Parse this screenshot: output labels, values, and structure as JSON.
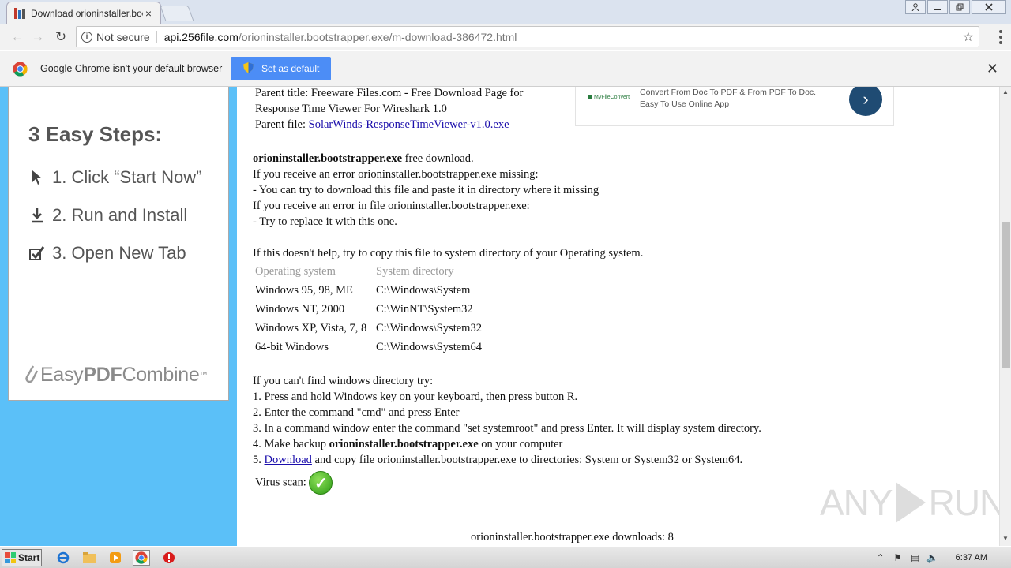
{
  "browser": {
    "tab_title": "Download orioninstaller.boot",
    "tab_close": "×",
    "url_security": "Not secure",
    "url_host": "api.256file.com",
    "url_path": "/orioninstaller.bootstrapper.exe/m-download-386472.html",
    "infobar_text": "Google Chrome isn't your default browser",
    "infobar_button": "Set as default"
  },
  "left_ad": {
    "title": "3 Easy Steps:",
    "steps": [
      "1. Click “Start Now”",
      "2. Run and Install",
      "3. Open New Tab"
    ],
    "brand_light": "Easy",
    "brand_bold": "PDF",
    "brand_rest": "Combine",
    "brand_tm": "™"
  },
  "right_ad": {
    "logo_text": "MyFileConvert",
    "line1": "Convert From Doc To PDF & From PDF To Doc.",
    "line2": "Easy To Use Online App"
  },
  "content": {
    "parent_title_line1": "Parent title: Freeware Files.com - Free Download Page for",
    "parent_title_line2": "Response Time Viewer For Wireshark 1.0",
    "parent_file_label": "Parent file: ",
    "parent_file_link": "SolarWinds-ResponseTimeViewer-v1.0.exe",
    "filename": "orioninstaller.bootstrapper.exe",
    "free_download": " free download.",
    "p1": "If you receive an error orioninstaller.bootstrapper.exe missing:",
    "p2": "- You can try to download this file and paste it in directory where it missing",
    "p3": "If you receive an error in file orioninstaller.bootstrapper.exe:",
    "p4": "- Try to replace it with this one.",
    "p5": "If this doesn't help, try to copy this file to system directory of your Operating system.",
    "table": {
      "headers": [
        "Operating system",
        "System directory"
      ],
      "rows": [
        [
          "Windows 95, 98, ME",
          "C:\\Windows\\System"
        ],
        [
          "Windows NT, 2000",
          "C:\\WinNT\\System32"
        ],
        [
          "Windows XP, Vista, 7, 8",
          "C:\\Windows\\System32"
        ],
        [
          "64-bit Windows",
          "C:\\Windows\\System64"
        ]
      ]
    },
    "s0": "If you can't find windows directory try:",
    "s1": "1. Press and hold Windows key on your keyboard, then press button R.",
    "s2": "2. Enter the command \"cmd\" and press Enter",
    "s3": "3. In a command window enter the command \"set systemroot\" and press Enter. It will display system directory.",
    "s4_pre": "4. Make backup ",
    "s4_post": " on your computer",
    "s5_pre": "5. ",
    "s5_link": "Download",
    "s5_post": " and copy file orioninstaller.bootstrapper.exe to directories: System or System32 or System64.",
    "virus_scan": "Virus scan:",
    "downloads": "orioninstaller.bootstrapper.exe downloads: 8"
  },
  "watermark": {
    "left": "ANY",
    "right": "RUN"
  },
  "taskbar": {
    "start_label": "Start",
    "clock": "6:37 AM"
  },
  "colors": {
    "left_bg": "#5bc0f8",
    "infobar_button": "#4c8df6",
    "link": "#1a0dab"
  }
}
